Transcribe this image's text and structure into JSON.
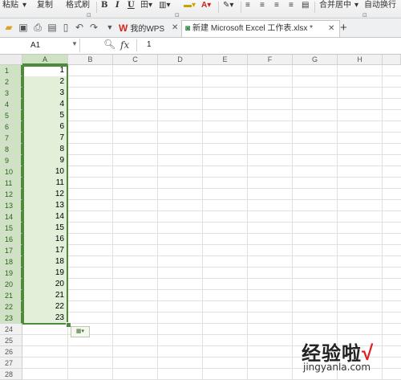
{
  "ribbon": {
    "paste": "粘贴",
    "copy": "复制",
    "format_painter": "格式刷",
    "bold": "B",
    "italic": "I",
    "underline": "U",
    "merge_center": "合并居中",
    "auto_wrap": "自动换行"
  },
  "tabs": [
    {
      "label": "我的WPS",
      "active": false
    },
    {
      "label": "新建 Microsoft Excel 工作表.xlsx *",
      "active": true
    }
  ],
  "formula_bar": {
    "name_box": "A1",
    "fx_label": "fx",
    "value": "1"
  },
  "columns": [
    "A",
    "B",
    "C",
    "D",
    "E",
    "F",
    "G",
    "H"
  ],
  "rows": [
    "1",
    "2",
    "3",
    "4",
    "5",
    "6",
    "7",
    "8",
    "9",
    "10",
    "11",
    "12",
    "13",
    "14",
    "15",
    "16",
    "17",
    "18",
    "19",
    "20",
    "21",
    "22",
    "23",
    "24",
    "25",
    "26",
    "27",
    "28"
  ],
  "column_a_values": [
    "1",
    "2",
    "3",
    "4",
    "5",
    "6",
    "7",
    "8",
    "9",
    "10",
    "11",
    "12",
    "13",
    "14",
    "15",
    "16",
    "17",
    "18",
    "19",
    "20",
    "21",
    "22",
    "23"
  ],
  "watermark": {
    "text": "经验啦",
    "url": "jingyanla.com"
  },
  "colors": {
    "selection_fill": "#e2efd9",
    "selection_border": "#4d8a3c",
    "wps_red": "#d7261c"
  }
}
